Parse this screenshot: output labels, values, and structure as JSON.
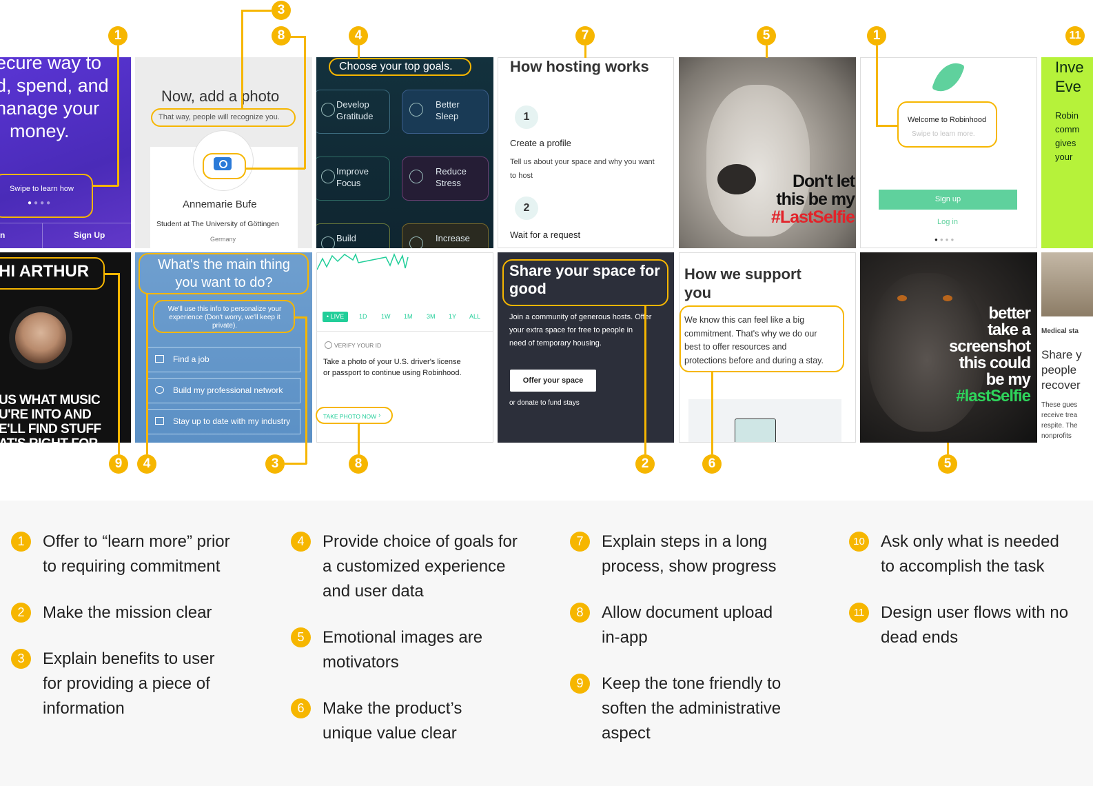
{
  "colors": {
    "accent": "#f6b600",
    "robinhood_green": "#5fd19d",
    "purple": "#5b2ec9"
  },
  "screens": {
    "s1": {
      "heading_lines": [
        "ecure way to",
        "d, spend, and",
        "nanage your",
        "money."
      ],
      "swipe": "Swipe to learn how",
      "signin": "n",
      "signup": "Sign Up"
    },
    "s2": {
      "title": "Now, add a photo",
      "subtitle": "That way, people will recognize you.",
      "name": "Annemarie Bufe",
      "school": "Student at The University of Göttingen",
      "country": "Germany",
      "camera_icon": "camera-icon"
    },
    "s3": {
      "title": "Choose your top goals.",
      "goals": [
        "Develop\nGratitude",
        "Better\nSleep",
        "Improve\nFocus",
        "Reduce\nStress",
        "Build",
        "Increase"
      ]
    },
    "s4": {
      "title": "How hosting works",
      "step1_num": "1",
      "step1_title": "Create a profile",
      "step1_desc": "Tell us about your space and why you want\nto host",
      "step2_num": "2",
      "step2_title": "Wait for a request"
    },
    "s5": {
      "caption_l1": "Don't let",
      "caption_l2": "this be my",
      "caption_tag": "#LastSelfie"
    },
    "s6": {
      "welcome": "Welcome to Robinhood",
      "swipe": "Swipe to learn more.",
      "signup": "Sign up",
      "login": "Log in"
    },
    "s7": {
      "text_lines": [
        "Inve",
        "Eve"
      ],
      "body_lines": [
        "Robin",
        "comm",
        "gives",
        "your"
      ]
    },
    "s8": {
      "title": "HI ARTHUR",
      "lines": [
        "US WHAT MUSIC",
        "U'RE INTO AND",
        "E'LL FIND STUFF",
        "AT'S RIGHT FOR"
      ]
    },
    "s9": {
      "title": "What's the main thing\nyou want to do?",
      "subtitle": "We'll use this info to personalize your\nexperience (Don't worry, we'll keep it\nprivate).",
      "options": [
        "Find a job",
        "Build my professional network",
        "Stay up to date with my industry"
      ]
    },
    "s10": {
      "live": "• LIVE",
      "ranges": [
        "1D",
        "1W",
        "1M",
        "3M",
        "1Y",
        "ALL"
      ],
      "verify": "VERIFY YOUR ID",
      "desc": "Take a photo of your U.S. driver's license\nor passport to continue using Robinhood.",
      "cta": "TAKE PHOTO NOW"
    },
    "s11": {
      "title": "Share your space for\ngood",
      "desc": "Join a community of generous hosts. Offer\nyour extra space for free to people in\nneed of temporary housing.",
      "button": "Offer your space",
      "donate": "or donate to fund stays"
    },
    "s12": {
      "title": "How we support\nyou",
      "desc": "We know this can feel like a big\ncommitment. That's why we do our\nbest to offer resources and\nprotections before and during a stay."
    },
    "s13": {
      "caption_lines": [
        "better",
        "take a",
        "screenshot",
        "this could",
        "be my"
      ],
      "caption_tag": "#lastSelfie"
    },
    "s14": {
      "tag": "Medical sta",
      "lines": [
        "Share y",
        "people",
        "recover"
      ],
      "small_lines": [
        "These gues",
        "receive trea",
        "respite. The",
        "nonprofits"
      ]
    }
  },
  "badges": {
    "top": [
      "1",
      "3",
      "8",
      "4",
      "7",
      "5",
      "1",
      "11"
    ],
    "bottom": [
      "9",
      "4",
      "3",
      "8",
      "2",
      "6",
      "5"
    ]
  },
  "legend": [
    {
      "num": "1",
      "text": "Offer to “learn more” prior\nto requiring commitment"
    },
    {
      "num": "2",
      "text": "Make the mission clear"
    },
    {
      "num": "3",
      "text": "Explain benefits to user\nfor providing a piece of\ninformation"
    },
    {
      "num": "4",
      "text": "Provide choice of goals for\na customized experience\nand user data"
    },
    {
      "num": "5",
      "text": "Emotional images are\nmotivators"
    },
    {
      "num": "6",
      "text": "Make the product’s\nunique value clear"
    },
    {
      "num": "7",
      "text": "Explain steps in a long\nprocess, show progress"
    },
    {
      "num": "8",
      "text": "Allow document upload\nin-app"
    },
    {
      "num": "9",
      "text": "Keep the tone friendly to\nsoften the administrative\naspect"
    },
    {
      "num": "10",
      "text": "Ask only what is needed\nto accomplish the task"
    },
    {
      "num": "11",
      "text": "Design user flows with no\ndead ends"
    }
  ]
}
